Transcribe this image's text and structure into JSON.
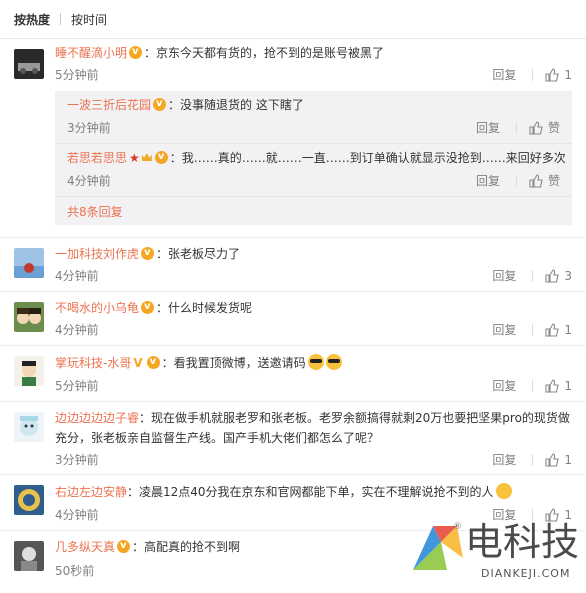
{
  "tabs": [
    "按热度",
    "按时间"
  ],
  "comments": [
    {
      "user": "睡不醒滴小明",
      "text": "：京东今天都有货的，抢不到的是账号被黑了",
      "time": "5分钟前",
      "reply": "回复",
      "likes": "1"
    },
    {
      "user": "一加科技刘作虎",
      "text": "：张老板尽力了",
      "time": "4分钟前",
      "reply": "回复",
      "likes": "3"
    },
    {
      "user": "不喝水的小乌龟",
      "text": "：什么时候发货呢",
      "time": "4分钟前",
      "reply": "回复",
      "likes": "1"
    },
    {
      "user": "掌玩科技-水哥",
      "text": "：看我置顶微博，送邀请码",
      "time": "5分钟前",
      "reply": "回复",
      "likes": "1"
    },
    {
      "user": "边边边边边子睿",
      "text": "：现在做手机就服老罗和张老板。老罗余额搞得就剩20万也要把坚果pro的现货做",
      "text2": "充分，张老板亲自监督生产线。国产手机大佬们都怎么了呢？",
      "time": "3分钟前",
      "reply": "回复",
      "likes": "1"
    },
    {
      "user": "右边左边安静",
      "text": "：凌晨12点40分我在京东和官网都能下单，实在不理解说抢不到的人",
      "time": "4分钟前",
      "reply": "回复",
      "likes": "1"
    },
    {
      "user": "几多纵天真",
      "text": "：高配真的抢不到啊",
      "time": "50秒前"
    }
  ],
  "replies": [
    {
      "user": "一波三折后花园",
      "text": "：没事随退货的 这下瞎了",
      "time": "3分钟前",
      "reply": "回复",
      "like": "赞"
    },
    {
      "user": "若思若思思",
      "text": "：我……真的……就……一直……到订单确认就显示没抢到……来回好多次",
      "time": "4分钟前",
      "reply": "回复",
      "like": "赞"
    }
  ],
  "more_replies": "共8条回复",
  "watermark": {
    "cn": "电科技",
    "en": "DIANKEJI.COM",
    "reg": "®"
  },
  "colors": {
    "accent": "#eb7350",
    "muted": "#808080"
  }
}
